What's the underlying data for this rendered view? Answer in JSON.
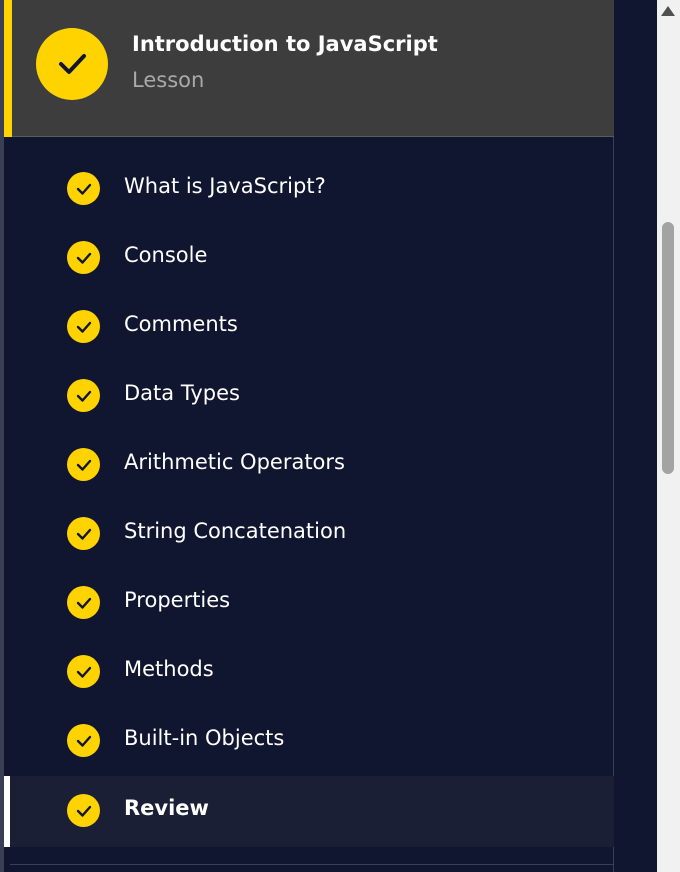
{
  "lesson": {
    "title": "Introduction to JavaScript",
    "subtitle": "Lesson",
    "status_icon": "check-icon",
    "accent_color": "#ffd300"
  },
  "items": [
    {
      "label": "What is JavaScript?",
      "completed": true
    },
    {
      "label": "Console",
      "completed": true
    },
    {
      "label": "Comments",
      "completed": true
    },
    {
      "label": "Data Types",
      "completed": true
    },
    {
      "label": "Arithmetic Operators",
      "completed": true
    },
    {
      "label": "String Concatenation",
      "completed": true
    },
    {
      "label": "Properties",
      "completed": true
    },
    {
      "label": "Methods",
      "completed": true
    },
    {
      "label": "Built-in Objects",
      "completed": true
    },
    {
      "label": "Review",
      "completed": true,
      "active": true
    }
  ],
  "scrollbar": {
    "up_icon": "triangle-up-icon"
  },
  "colors": {
    "background": "#10162f",
    "header": "#3d3d3d",
    "check": "#ffd300"
  }
}
